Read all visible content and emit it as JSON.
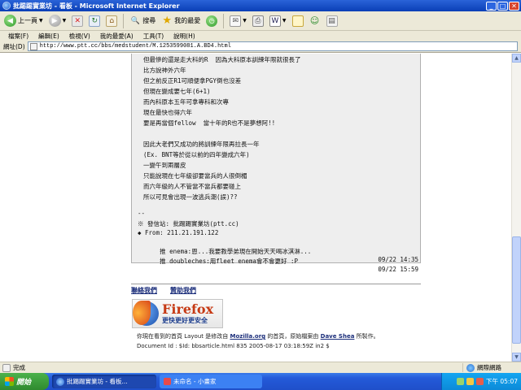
{
  "window": {
    "title": "批踢踢實業坊 - 看板 - Microsoft Internet Explorer",
    "buttons": [
      "_",
      "□",
      "✕"
    ]
  },
  "toolbar": {
    "back_label": "上一頁",
    "search_label": "搜尋",
    "favorites_label": "我的最愛"
  },
  "menu": [
    "檔案(F)",
    "編輯(E)",
    "檢視(V)",
    "我的最愛(A)",
    "工具(T)",
    "說明(H)"
  ],
  "address": {
    "label": "網址(D)",
    "url": "http://www.ptt.cc/bbs/medstudent/M.1253599081.A.BD4.html"
  },
  "post": {
    "lines": [
      "但最慘的還是走大科的R  因為大科原本訓練年限就很長了",
      "比方說神外六年",
      "但之前反正R1可順便拿PGY倒也沒差",
      "但現在變成要七年(6+1)",
      "而內科原本五年可拿專科和次專",
      "現在最快也得六年",
      "要是再當個fellow  當十年的R也不是夢想阿!!",
      "",
      "因此大老們又成功的將訓練年限再拉長一年",
      "(Ex. BNT等於從以前的四年變成六年)",
      "一變午到兩層皮",
      "只能說現在七年級卻要當兵的人很倒楣",
      "而六年級的人不管當不當兵都要碰上",
      "所以可見會出現一波逃兵潮(誤)??",
      "",
      "--",
      "※ 發信站: 批踢踢實業坊(ptt.cc)",
      "◆ From: 211.21.191.122"
    ],
    "pushes": [
      {
        "text": "推 enema:恩...我要教學弟現在開始天天喝冰淇淋...",
        "time": "09/22 14:35"
      },
      {
        "text": "推 doubleches:用fleet enema會不會更好 :P",
        "time": "09/22 15:59"
      }
    ]
  },
  "footer": {
    "links": [
      "聯絡我們",
      "贊助我們"
    ],
    "firefox_title": "Firefox",
    "firefox_sub": "更快更好更安全",
    "credit_1a": "你現在看到的首頁 Layout 是修改自 ",
    "credit_1b": "Mozilla.org",
    "credit_1c": " 的首頁，原始檔案由 ",
    "credit_1d": "Dave Shea",
    "credit_1e": " 所製作。",
    "credit_2": "Document Id : $Id: bbsarticle.html 835 2005-08-17 03:18:59Z in2 $"
  },
  "status": {
    "text": "完成",
    "zone": "網際網路"
  },
  "taskbar": {
    "start": "開始",
    "tasks": [
      "批踢踢實業坊 - 看板...",
      "未命名 - 小畫家"
    ],
    "clock": "下午 05:07"
  }
}
